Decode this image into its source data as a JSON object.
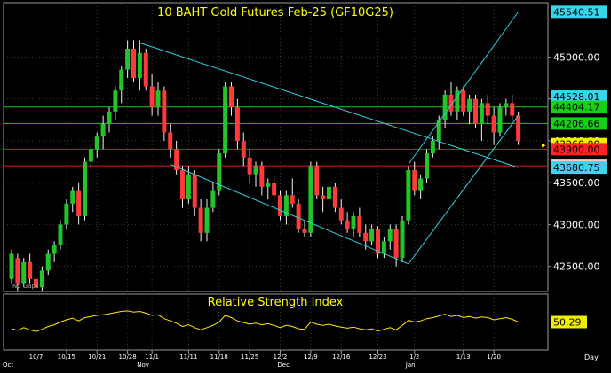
{
  "chart_data": [
    {
      "type": "candlestick",
      "title": "10  BAHT  Gold  Futures  Feb-25  (GF10G25)",
      "watermark": "No Gaps",
      "ylim": [
        42200,
        45650
      ],
      "y_ticks": [
        42500,
        43000,
        43500,
        44000,
        44500,
        45000
      ],
      "y_tick_labels": [
        "42500.00",
        "43000.00",
        "43500.00",
        "44000.00",
        "44500.00",
        "45000.00"
      ],
      "date_ticks": [
        {
          "i": 4,
          "label": "10/7"
        },
        {
          "i": 9,
          "label": "10/15"
        },
        {
          "i": 14,
          "label": "10/21"
        },
        {
          "i": 19,
          "label": "10/28"
        },
        {
          "i": 23,
          "label": "11/1"
        },
        {
          "i": 29,
          "label": "11/11"
        },
        {
          "i": 34,
          "label": "11/18"
        },
        {
          "i": 39,
          "label": "11/25"
        },
        {
          "i": 44,
          "label": "12/2"
        },
        {
          "i": 49,
          "label": "12/9"
        },
        {
          "i": 54,
          "label": "12/16"
        },
        {
          "i": 60,
          "label": "12/23"
        },
        {
          "i": 66,
          "label": "1/2"
        },
        {
          "i": 74,
          "label": "1/13"
        },
        {
          "i": 79,
          "label": "1/20"
        }
      ],
      "month_labels": [
        {
          "i": 0,
          "label": "Oct"
        },
        {
          "i": 22,
          "label": "Nov"
        },
        {
          "i": 45,
          "label": "Dec"
        },
        {
          "i": 66,
          "label": "Jan"
        }
      ],
      "period_label": "Day",
      "colors": {
        "up": "#22c42a",
        "down": "#ff3a3a",
        "channel": "#31cfe0",
        "support": "#1ec81e",
        "resistance": "#e01818"
      },
      "price_labels": [
        {
          "value": 45540.51,
          "text": "45540.51",
          "bg": "#38d5ec"
        },
        {
          "value": 44528.01,
          "text": "44528.01",
          "bg": "#38d5ec"
        },
        {
          "value": 44404.17,
          "text": "44404.17",
          "bg": "#18d018"
        },
        {
          "value": 44206.66,
          "text": "44206.66",
          "bg": "#18d018"
        },
        {
          "value": 43960.0,
          "text": "43960.00",
          "bg": "#f0f000"
        },
        {
          "value": 43900.0,
          "text": "43900.00",
          "bg": "#ff2222"
        },
        {
          "value": 43701.67,
          "text": "43701.67",
          "bg": "#ffc8c0"
        },
        {
          "value": 43680.75,
          "text": "43680.75",
          "bg": "#38d5ec"
        }
      ],
      "horizontal_lines": [
        {
          "value": 44404.17,
          "color": "support"
        },
        {
          "value": 44206.66,
          "color": "support"
        },
        {
          "value": 43900.0,
          "color": "resistance"
        },
        {
          "value": 43701.67,
          "color": "resistance"
        }
      ],
      "trendlines": [
        {
          "from": [
            21,
            45170
          ],
          "to": [
            83,
            43680
          ]
        },
        {
          "from": [
            26,
            43720
          ],
          "to": [
            65,
            42530
          ]
        },
        {
          "from": [
            65,
            42530
          ],
          "to": [
            83,
            44300
          ]
        },
        {
          "from": [
            65,
            43720
          ],
          "to": [
            83,
            45540
          ]
        }
      ],
      "ohlc": [
        [
          42350,
          42700,
          42300,
          42650
        ],
        [
          42600,
          42650,
          42200,
          42300
        ],
        [
          42300,
          42600,
          42250,
          42550
        ],
        [
          42550,
          42650,
          42300,
          42350
        ],
        [
          42350,
          42420,
          42180,
          42250
        ],
        [
          42250,
          42500,
          42200,
          42450
        ],
        [
          42450,
          42700,
          42400,
          42650
        ],
        [
          42650,
          42800,
          42550,
          42750
        ],
        [
          42750,
          43050,
          42700,
          43000
        ],
        [
          43000,
          43300,
          42950,
          43250
        ],
        [
          43250,
          43450,
          43150,
          43400
        ],
        [
          43400,
          43500,
          43000,
          43100
        ],
        [
          43100,
          43800,
          43050,
          43750
        ],
        [
          43750,
          43950,
          43650,
          43900
        ],
        [
          43900,
          44100,
          43800,
          44050
        ],
        [
          44050,
          44300,
          43900,
          44200
        ],
        [
          44200,
          44400,
          44100,
          44350
        ],
        [
          44350,
          44650,
          44250,
          44600
        ],
        [
          44600,
          44900,
          44450,
          44850
        ],
        [
          44850,
          45200,
          44750,
          45100
        ],
        [
          45100,
          45200,
          44700,
          44750
        ],
        [
          44750,
          45200,
          44600,
          45050
        ],
        [
          45050,
          45100,
          44600,
          44650
        ],
        [
          44650,
          44800,
          44300,
          44400
        ],
        [
          44400,
          44700,
          44300,
          44600
        ],
        [
          44600,
          44650,
          44000,
          44100
        ],
        [
          44100,
          44200,
          43800,
          43900
        ],
        [
          43900,
          44000,
          43600,
          43650
        ],
        [
          43650,
          43700,
          43200,
          43300
        ],
        [
          43300,
          43700,
          43250,
          43600
        ],
        [
          43600,
          43650,
          43100,
          43200
        ],
        [
          43200,
          43300,
          42800,
          42900
        ],
        [
          42900,
          43300,
          42800,
          43200
        ],
        [
          43200,
          43500,
          43150,
          43400
        ],
        [
          43400,
          43900,
          43350,
          43850
        ],
        [
          43850,
          44700,
          43800,
          44650
        ],
        [
          44650,
          44700,
          44300,
          44400
        ],
        [
          44400,
          44500,
          43900,
          44000
        ],
        [
          44000,
          44100,
          43700,
          43800
        ],
        [
          43800,
          43900,
          43500,
          43600
        ],
        [
          43600,
          43750,
          43450,
          43700
        ],
        [
          43700,
          43750,
          43350,
          43450
        ],
        [
          43450,
          43550,
          43300,
          43500
        ],
        [
          43500,
          43600,
          43300,
          43350
        ],
        [
          43350,
          43400,
          43050,
          43100
        ],
        [
          43100,
          43400,
          43000,
          43350
        ],
        [
          43350,
          43550,
          43200,
          43250
        ],
        [
          43250,
          43300,
          42900,
          42950
        ],
        [
          42950,
          43050,
          42850,
          42900
        ],
        [
          42900,
          43750,
          42850,
          43700
        ],
        [
          43700,
          43750,
          43300,
          43350
        ],
        [
          43350,
          43450,
          43150,
          43300
        ],
        [
          43300,
          43500,
          43250,
          43450
        ],
        [
          43450,
          43500,
          43150,
          43200
        ],
        [
          43200,
          43300,
          43000,
          43050
        ],
        [
          43050,
          43150,
          42900,
          42950
        ],
        [
          42950,
          43150,
          42850,
          43100
        ],
        [
          43100,
          43200,
          42850,
          42900
        ],
        [
          42900,
          43000,
          42700,
          42800
        ],
        [
          42800,
          43000,
          42750,
          42950
        ],
        [
          42950,
          42980,
          42600,
          42650
        ],
        [
          42650,
          42850,
          42600,
          42800
        ],
        [
          42800,
          43000,
          42700,
          42950
        ],
        [
          42950,
          43000,
          42500,
          42600
        ],
        [
          42600,
          43100,
          42550,
          43050
        ],
        [
          43050,
          43700,
          43000,
          43650
        ],
        [
          43650,
          43750,
          43350,
          43400
        ],
        [
          43400,
          43600,
          43300,
          43550
        ],
        [
          43550,
          43900,
          43500,
          43850
        ],
        [
          43850,
          44050,
          43800,
          44000
        ],
        [
          44000,
          44300,
          43900,
          44250
        ],
        [
          44250,
          44600,
          44150,
          44550
        ],
        [
          44550,
          44700,
          44300,
          44350
        ],
        [
          44350,
          44650,
          44250,
          44600
        ],
        [
          44600,
          44650,
          44300,
          44350
        ],
        [
          44350,
          44550,
          44200,
          44500
        ],
        [
          44500,
          44550,
          44150,
          44200
        ],
        [
          44200,
          44500,
          44000,
          44450
        ],
        [
          44450,
          44550,
          44200,
          44300
        ],
        [
          44300,
          44400,
          43950,
          44100
        ],
        [
          44100,
          44450,
          44050,
          44400
        ],
        [
          44400,
          44500,
          44300,
          44450
        ],
        [
          44450,
          44550,
          44250,
          44300
        ],
        [
          44300,
          44350,
          43950,
          44000
        ]
      ]
    },
    {
      "type": "line",
      "title": "Relative  Strength  Index",
      "ylim": [
        0,
        100
      ],
      "series": [
        {
          "color": "#ffe800",
          "values": [
            38,
            35,
            40,
            36,
            33,
            37,
            42,
            45,
            50,
            54,
            57,
            52,
            58,
            60,
            62,
            63,
            65,
            67,
            69,
            70,
            68,
            69,
            66,
            62,
            63,
            56,
            52,
            48,
            42,
            45,
            40,
            36,
            40,
            44,
            50,
            62,
            58,
            52,
            49,
            46,
            48,
            45,
            47,
            44,
            40,
            44,
            42,
            38,
            37,
            50,
            46,
            44,
            46,
            43,
            41,
            39,
            41,
            38,
            36,
            38,
            34,
            37,
            40,
            36,
            44,
            53,
            50,
            52,
            56,
            58,
            61,
            64,
            60,
            62,
            58,
            60,
            57,
            59,
            58,
            54,
            56,
            58,
            55,
            50
          ]
        }
      ],
      "last_value_label": "50.29"
    }
  ]
}
